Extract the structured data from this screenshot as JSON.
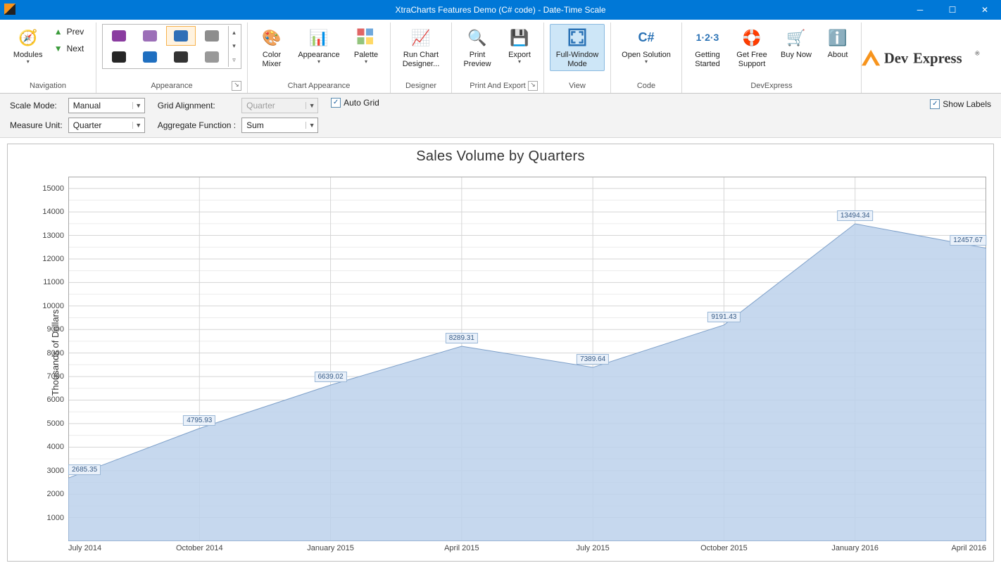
{
  "window": {
    "title": "XtraCharts Features Demo (C# code) - Date-Time Scale"
  },
  "ribbon": {
    "nav": {
      "modules": "Modules",
      "prev": "Prev",
      "next": "Next",
      "group": "Navigation"
    },
    "appearance_group": "Appearance",
    "chart_appearance": {
      "color_mixer": "Color\nMixer",
      "appearance": "Appearance",
      "palette": "Palette",
      "group": "Chart Appearance"
    },
    "designer": {
      "run": "Run Chart\nDesigner...",
      "group": "Designer"
    },
    "print_export": {
      "preview": "Print\nPreview",
      "export": "Export",
      "group": "Print And Export"
    },
    "view": {
      "full_window": "Full-Window\nMode",
      "group": "View"
    },
    "code": {
      "open_solution": "Open Solution",
      "group": "Code"
    },
    "devexpress": {
      "getting_started": "Getting\nStarted",
      "get_free_support": "Get Free\nSupport",
      "buy_now": "Buy Now",
      "about": "About",
      "group": "DevExpress"
    },
    "brand": "DevExpress"
  },
  "options": {
    "scale_mode_label": "Scale Mode:",
    "scale_mode_value": "Manual",
    "measure_unit_label": "Measure Unit:",
    "measure_unit_value": "Quarter",
    "grid_alignment_label": "Grid Alignment:",
    "grid_alignment_value": "Quarter",
    "aggregate_label": "Aggregate Function :",
    "aggregate_value": "Sum",
    "auto_grid_label": "Auto Grid",
    "auto_grid_checked": true,
    "show_labels_label": "Show Labels",
    "show_labels_checked": true
  },
  "chart_data": {
    "type": "area",
    "title": "Sales Volume by Quarters",
    "ylabel": "Thousands of Dollars",
    "xlabel": "",
    "ylim": [
      0,
      15500
    ],
    "yticks": [
      1000,
      2000,
      3000,
      4000,
      5000,
      6000,
      7000,
      8000,
      9000,
      10000,
      11000,
      12000,
      13000,
      14000,
      15000
    ],
    "categories": [
      "July 2014",
      "October 2014",
      "January 2015",
      "April 2015",
      "July 2015",
      "October 2015",
      "January 2016",
      "April 2016"
    ],
    "values": [
      2685.35,
      4795.93,
      6639.02,
      8289.31,
      7389.64,
      9191.43,
      13494.34,
      12457.67
    ],
    "data_labels": [
      "2685.35",
      "4795.93",
      "6639.02",
      "8289.31",
      "7389.64",
      "9191.43",
      "13494.34",
      "12457.67"
    ]
  }
}
